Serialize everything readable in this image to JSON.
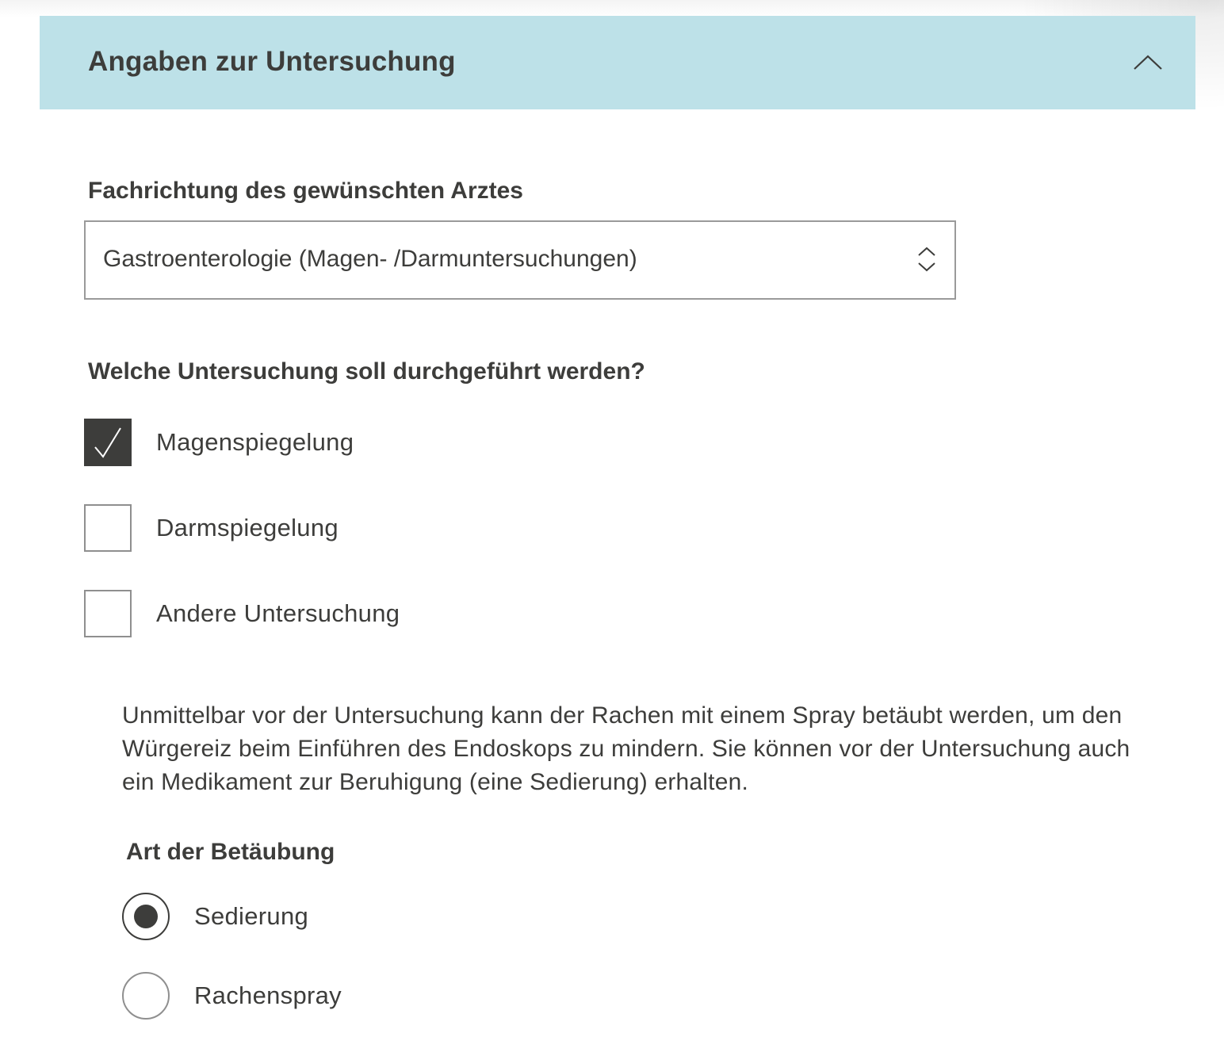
{
  "section": {
    "title": "Angaben zur Untersuchung",
    "toggle_icon": "chevron-up-icon",
    "header_color": "#bde1e8"
  },
  "specialty": {
    "label": "Fachrichtung des gewünschten Arztes",
    "selected_value": "Gastroenterologie (Magen- /Darmuntersuchungen)",
    "icon": "select-arrows-icon"
  },
  "examination": {
    "question": "Welche Untersuchung soll durchgeführt werden?",
    "options": [
      {
        "label": "Magenspiegelung",
        "checked": true
      },
      {
        "label": "Darmspiegelung",
        "checked": false
      },
      {
        "label": "Andere Untersuchung",
        "checked": false
      }
    ]
  },
  "info_text": "Unmittelbar vor der Untersuchung kann der Rachen mit einem Spray betäubt werden, um den Würgereiz beim Einführen des Endoskops zu mindern. Sie können vor der Untersuchung auch ein Medikament zur Beruhigung (eine Sedierung) erhalten.",
  "anesthesia": {
    "label": "Art der Betäubung",
    "options": [
      {
        "label": "Sedierung",
        "selected": true
      },
      {
        "label": "Rachenspray",
        "selected": false
      }
    ]
  }
}
